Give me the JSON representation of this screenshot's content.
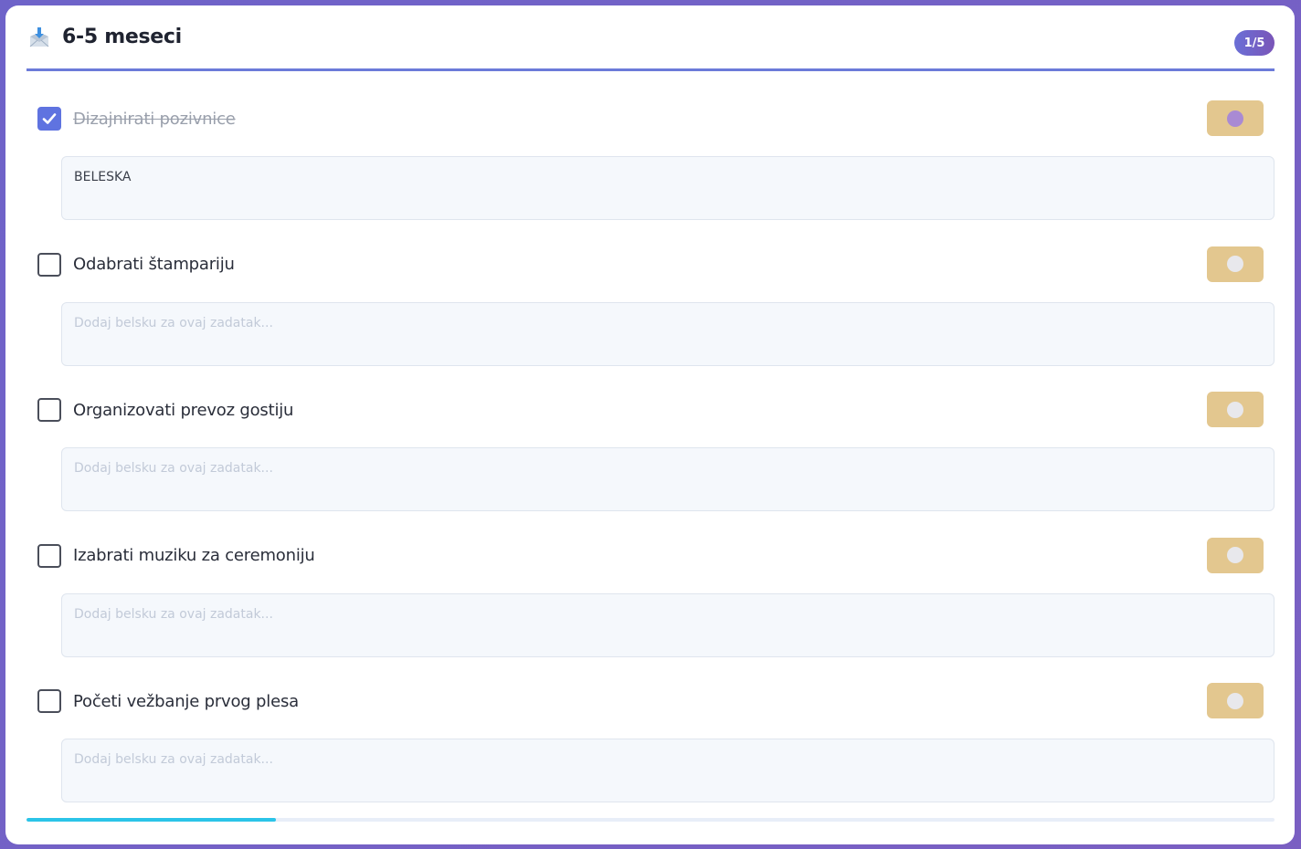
{
  "header": {
    "title": "6-5 meseci",
    "icon": "inbox-download-icon",
    "counter": "1/5"
  },
  "colors": {
    "accent": "#5f73e0",
    "toggle_bg": "#e3c78f",
    "toggle_on_dot": "#a98ad3",
    "progress": "#2bc4e8"
  },
  "tasks": [
    {
      "label": "Dizajnirati pozivnice",
      "checked": true,
      "note": "BELESKA",
      "placeholder": "Dodaj belsku za ovaj zadatak..."
    },
    {
      "label": "Odabrati štampariju",
      "checked": false,
      "note": "",
      "placeholder": "Dodaj belsku za ovaj zadatak..."
    },
    {
      "label": "Organizovati prevoz gostiju",
      "checked": false,
      "note": "",
      "placeholder": "Dodaj belsku za ovaj zadatak..."
    },
    {
      "label": "Izabrati muziku za ceremoniju",
      "checked": false,
      "note": "",
      "placeholder": "Dodaj belsku za ovaj zadatak..."
    },
    {
      "label": "Početi vežbanje prvog plesa",
      "checked": false,
      "note": "",
      "placeholder": "Dodaj belsku za ovaj zadatak..."
    }
  ],
  "progress": {
    "fraction": 0.2
  }
}
